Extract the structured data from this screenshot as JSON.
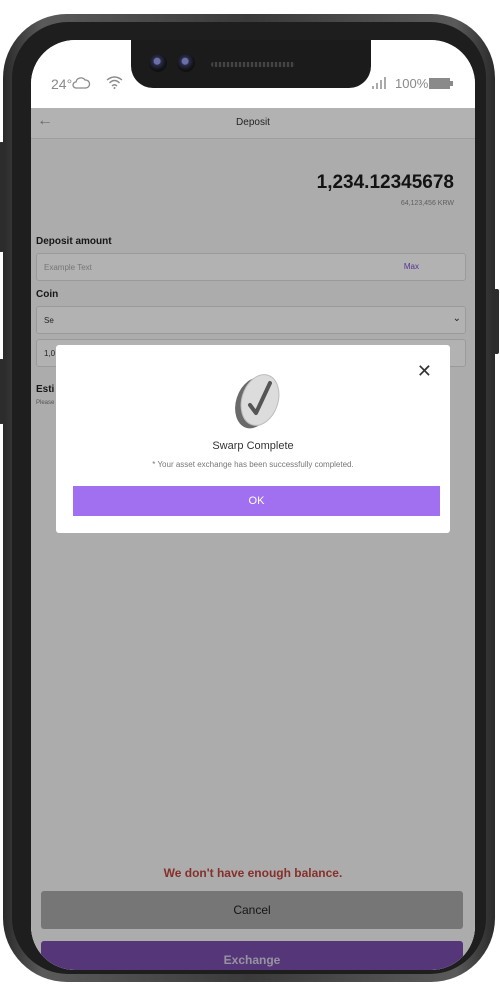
{
  "status_bar": {
    "temperature": "24°",
    "battery": "100%",
    "weather_icon": "cloud-icon",
    "wifi_icon": "wifi-icon",
    "signal_icon": "signal-icon",
    "battery_icon": "battery-icon"
  },
  "header": {
    "title": "Deposit",
    "back_icon": "back-arrow-icon"
  },
  "balance": {
    "amount": "1,234.12345678",
    "krw": "64,123,456 KRW"
  },
  "deposit": {
    "label": "Deposit amount",
    "placeholder": "Example Text",
    "max_label": "Max"
  },
  "coin": {
    "label": "Coin",
    "select_text": "Se",
    "amount_text": "1,0",
    "chevron_icon": "chevron-down-icon"
  },
  "estimate": {
    "label": "Esti",
    "note": "Please"
  },
  "modal": {
    "title": "Swarp Complete",
    "message": "* Your asset exchange has been successfully completed.",
    "ok_label": "OK",
    "close_icon": "close-icon",
    "check_icon": "check-coin-icon"
  },
  "warning": "We don't have enough balance.",
  "buttons": {
    "cancel": "Cancel",
    "exchange": "Exchange"
  },
  "colors": {
    "accent": "#a070f0",
    "exchange": "#7a4fae",
    "warning": "#c1453f"
  }
}
